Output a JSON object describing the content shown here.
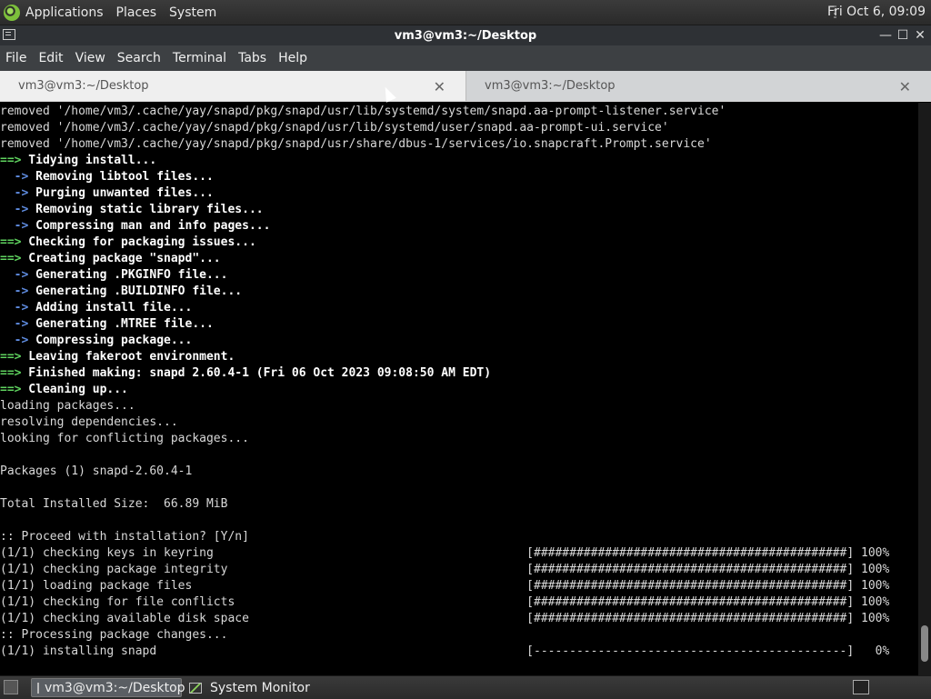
{
  "top_panel": {
    "menus": [
      "Applications",
      "Places",
      "System"
    ],
    "clock": "Fri Oct  6, 09:09"
  },
  "window": {
    "title": "vm3@vm3:~/Desktop",
    "minimize": "—",
    "maximize": "☐",
    "close": "✕"
  },
  "menubar": [
    "File",
    "Edit",
    "View",
    "Search",
    "Terminal",
    "Tabs",
    "Help"
  ],
  "tabs": [
    {
      "label": "vm3@vm3:~/Desktop",
      "active": true
    },
    {
      "label": "vm3@vm3:~/Desktop",
      "active": false
    }
  ],
  "terminal": {
    "lines": [
      {
        "text": "removed '/home/vm3/.cache/yay/snapd/pkg/snapd/usr/lib/systemd/system/snapd.aa-prompt-listener.service'"
      },
      {
        "text": "removed '/home/vm3/.cache/yay/snapd/pkg/snapd/usr/lib/systemd/user/snapd.aa-prompt-ui.service'"
      },
      {
        "text": "removed '/home/vm3/.cache/yay/snapd/pkg/snapd/usr/share/dbus-1/services/io.snapcraft.Prompt.service'"
      },
      {
        "prefix": "==>",
        "kind": "g",
        "text": " Tidying install..."
      },
      {
        "prefix": "  ->",
        "kind": "b",
        "text": " Removing libtool files..."
      },
      {
        "prefix": "  ->",
        "kind": "b",
        "text": " Purging unwanted files..."
      },
      {
        "prefix": "  ->",
        "kind": "b",
        "text": " Removing static library files..."
      },
      {
        "prefix": "  ->",
        "kind": "b",
        "text": " Compressing man and info pages..."
      },
      {
        "prefix": "==>",
        "kind": "g",
        "text": " Checking for packaging issues..."
      },
      {
        "prefix": "==>",
        "kind": "g",
        "text": " Creating package \"snapd\"..."
      },
      {
        "prefix": "  ->",
        "kind": "b",
        "text": " Generating .PKGINFO file..."
      },
      {
        "prefix": "  ->",
        "kind": "b",
        "text": " Generating .BUILDINFO file..."
      },
      {
        "prefix": "  ->",
        "kind": "b",
        "text": " Adding install file..."
      },
      {
        "prefix": "  ->",
        "kind": "b",
        "text": " Generating .MTREE file..."
      },
      {
        "prefix": "  ->",
        "kind": "b",
        "text": " Compressing package..."
      },
      {
        "prefix": "==>",
        "kind": "g",
        "text": " Leaving fakeroot environment."
      },
      {
        "prefix": "==>",
        "kind": "g",
        "text": " Finished making: snapd 2.60.4-1 (Fri 06 Oct 2023 09:08:50 AM EDT)"
      },
      {
        "prefix": "==>",
        "kind": "g",
        "text": " Cleaning up..."
      },
      {
        "text": "loading packages..."
      },
      {
        "text": "resolving dependencies..."
      },
      {
        "text": "looking for conflicting packages..."
      },
      {
        "text": ""
      },
      {
        "text": "Packages (1) snapd-2.60.4-1"
      },
      {
        "text": ""
      },
      {
        "text": "Total Installed Size:  66.89 MiB"
      },
      {
        "text": ""
      },
      {
        "text": ":: Proceed with installation? [Y/n]"
      },
      {
        "text": "(1/1) checking keys in keyring                                            [############################################] 100%"
      },
      {
        "text": "(1/1) checking package integrity                                          [############################################] 100%"
      },
      {
        "text": "(1/1) loading package files                                               [############################################] 100%"
      },
      {
        "text": "(1/1) checking for file conflicts                                         [############################################] 100%"
      },
      {
        "text": "(1/1) checking available disk space                                       [############################################] 100%"
      },
      {
        "text": ":: Processing package changes..."
      },
      {
        "text": "(1/1) installing snapd                                                    [--------------------------------------------]   0%"
      }
    ]
  },
  "taskbar": {
    "items": [
      "vm3@vm3:~/Desktop",
      "System Monitor"
    ]
  }
}
